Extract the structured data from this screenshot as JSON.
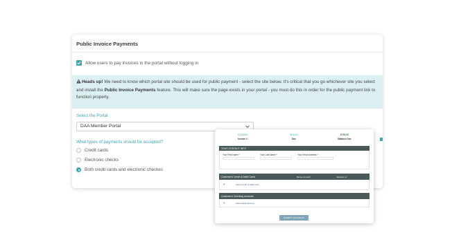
{
  "settings": {
    "title": "Public Invoice Payments",
    "allow_label": "Allow users to pay invoices in the portal without logging in",
    "alert": {
      "lead": "Heads up!",
      "text1": " We need to know which portal site should be used for public payment - select the site below. It's critical that you go whichever site you select and install the ",
      "feature": "Public Invoice Payments",
      "text2": " feature. This will make sure the page exists in your portal - you must do this in order for the public payment link to function properly."
    },
    "portal_label": "Select the Portal",
    "portal_value": "DAA Member Portal",
    "types_label": "What types of payments should be accepted?",
    "options": [
      {
        "label": "Credit cards",
        "selected": false
      },
      {
        "label": "Electronic checks",
        "selected": false
      },
      {
        "label": "Both credit cards and electronic checkes",
        "selected": true
      }
    ]
  },
  "payment_form": {
    "summary": [
      {
        "value": "12345010",
        "label": "Invoice #"
      },
      {
        "value": "6/16/22",
        "label": "Due"
      },
      {
        "value": "$750.00",
        "label": "Balance Due"
      }
    ],
    "contact_title": "YOUR CONTACT INFO",
    "first_name": "Your First Name *",
    "last_name": "Your Last Name *",
    "email": "Your Email Address *",
    "cards_title": "Customer's Credit & Debit Cards",
    "cards_col1": "Name on card",
    "cards_col2": "Expires on",
    "add_card": "Add a credit or debit card",
    "checking_title": "Customer's Checking Accounts",
    "add_bank": "Add a bank account",
    "submit": "SUBMIT PAYMENT"
  }
}
